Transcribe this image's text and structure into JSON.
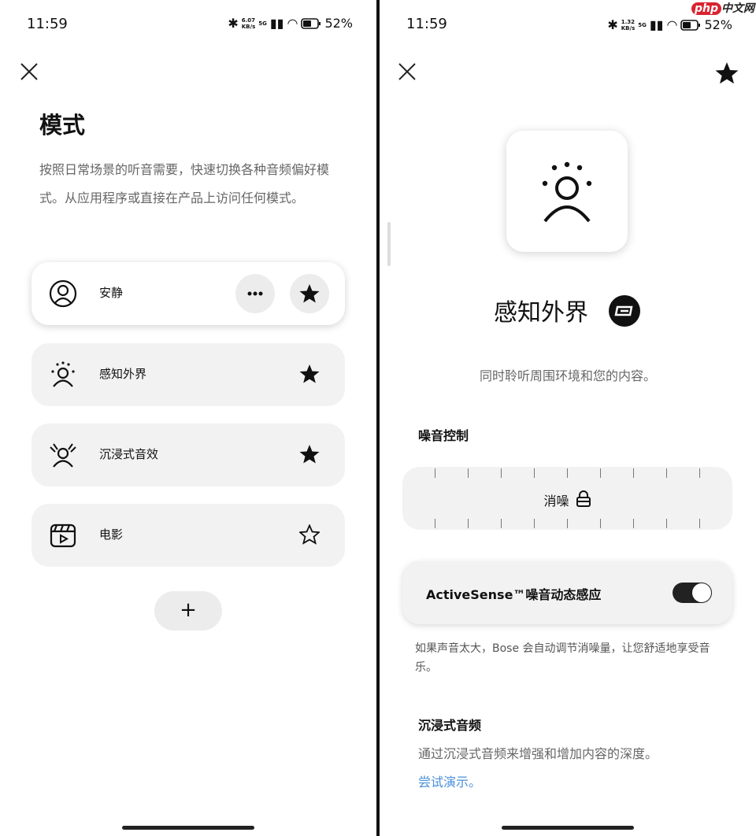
{
  "colors": {
    "accent_link": "#4a90d9",
    "card_bg": "#f2f2f2",
    "watermark_red": "#d9232f"
  },
  "left": {
    "status": {
      "time": "11:59",
      "net_speed": "6.07",
      "net_unit": "KB/s",
      "signal": "5G",
      "battery": "52%"
    },
    "close_icon": "close-icon",
    "title": "模式",
    "description": "按照日常场景的听音需要，快速切换各种音频偏好模式。从应用程序或直接在产品上访问任何模式。",
    "modes": [
      {
        "label": "安静",
        "icon": "quiet-person-icon",
        "starred": true,
        "active": true
      },
      {
        "label": "感知外界",
        "icon": "aware-person-icon",
        "starred": true,
        "active": false
      },
      {
        "label": "沉浸式音效",
        "icon": "immersion-person-icon",
        "starred": true,
        "active": false
      },
      {
        "label": "电影",
        "icon": "clapperboard-icon",
        "starred": false,
        "active": false
      }
    ],
    "more_icon": "more-icon",
    "add_label": "+"
  },
  "right": {
    "status": {
      "time": "11:59",
      "net_speed": "1.32",
      "net_unit": "KB/s",
      "signal": "5G",
      "battery": "52%"
    },
    "watermark": {
      "php": "php",
      "cn": "中文网"
    },
    "mode_title": "感知外界",
    "mode_subtitle": "同时聆听周围环境和您的内容。",
    "noise_section": "噪音控制",
    "slider_label": "消噪",
    "activesense_label": "ActiveSense™噪音动态感应",
    "activesense_on": true,
    "activesense_note": "如果声音太大，Bose 会自动调节消噪量，让您舒适地享受音乐。",
    "immersive_title": "沉浸式音频",
    "immersive_desc": "通过沉浸式音频来增强和增加内容的深度。",
    "demo_link": "尝试演示。"
  }
}
